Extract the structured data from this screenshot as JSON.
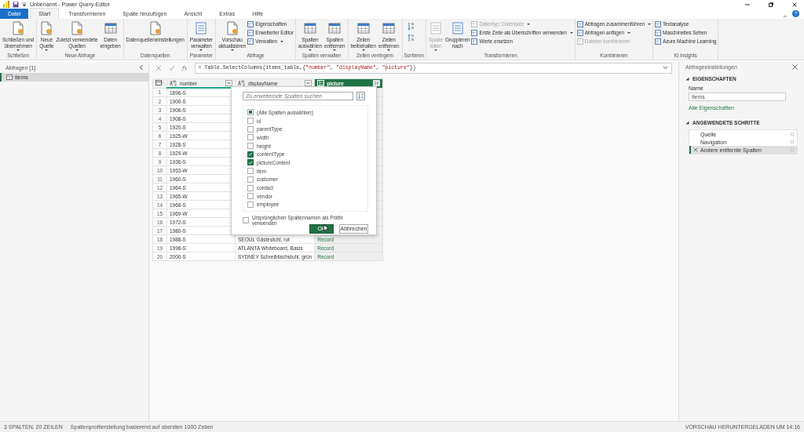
{
  "window": {
    "title": "Unbenannt - Power Query-Editor"
  },
  "tabs": [
    {
      "label": "Datei",
      "kind": "file",
      "selected": false
    },
    {
      "label": "Start",
      "kind": "tab",
      "selected": true
    },
    {
      "label": "Transformieren",
      "kind": "tab",
      "selected": false
    },
    {
      "label": "Spalte hinzufügen",
      "kind": "tab",
      "selected": false
    },
    {
      "label": "Ansicht",
      "kind": "tab",
      "selected": false
    },
    {
      "label": "Extras",
      "kind": "tab",
      "selected": false
    },
    {
      "label": "Hilfe",
      "kind": "tab",
      "selected": false
    }
  ],
  "ribbon": [
    {
      "label": "Schließen",
      "items": [
        {
          "kind": "large",
          "lines": [
            "Schließen und",
            "übernehmen"
          ],
          "dropdown": true,
          "disabled": false
        }
      ]
    },
    {
      "label": "Neue Abfrage",
      "items": [
        {
          "kind": "large",
          "lines": [
            "Neue",
            "Quelle"
          ],
          "dropdown": true,
          "disabled": false
        },
        {
          "kind": "large",
          "lines": [
            "Zuletzt verwendete",
            "Quellen"
          ],
          "dropdown": true,
          "disabled": false
        },
        {
          "kind": "large",
          "lines": [
            "Daten",
            "eingeben"
          ],
          "dropdown": false,
          "disabled": false
        }
      ]
    },
    {
      "label": "Datenquellen",
      "items": [
        {
          "kind": "large",
          "lines": [
            "Datenquelleneinstellungen"
          ],
          "dropdown": false,
          "disabled": false
        }
      ]
    },
    {
      "label": "Parameter",
      "items": [
        {
          "kind": "large",
          "lines": [
            "Parameter",
            "verwalten"
          ],
          "dropdown": true,
          "disabled": false
        }
      ]
    },
    {
      "label": "Abfrage",
      "items": [
        {
          "kind": "large",
          "lines": [
            "Vorschau",
            "aktualisieren"
          ],
          "dropdown": true,
          "disabled": false
        },
        {
          "kind": "stack",
          "items": [
            {
              "label": "Eigenschaften",
              "dropdown": false,
              "disabled": false
            },
            {
              "label": "Erweiterter Editor",
              "dropdown": false,
              "disabled": false
            },
            {
              "label": "Verwalten",
              "dropdown": true,
              "disabled": false
            }
          ]
        }
      ]
    },
    {
      "label": "Spalten verwalten",
      "items": [
        {
          "kind": "large",
          "lines": [
            "Spalten",
            "auswählen"
          ],
          "dropdown": true,
          "disabled": false
        },
        {
          "kind": "large",
          "lines": [
            "Spalten",
            "entfernen"
          ],
          "dropdown": true,
          "disabled": false
        }
      ]
    },
    {
      "label": "Zeilen verringern",
      "items": [
        {
          "kind": "large",
          "lines": [
            "Zeilen",
            "beibehalten"
          ],
          "dropdown": true,
          "disabled": false
        },
        {
          "kind": "large",
          "lines": [
            "Zeilen",
            "entfernen"
          ],
          "dropdown": true,
          "disabled": false
        }
      ]
    },
    {
      "label": "Sortieren",
      "items": [
        {
          "kind": "sort"
        }
      ]
    },
    {
      "label": "Transformieren",
      "items": [
        {
          "kind": "large",
          "lines": [
            "Spalte",
            "teilen"
          ],
          "dropdown": true,
          "disabled": true
        },
        {
          "kind": "large",
          "lines": [
            "Gruppieren",
            "nach"
          ],
          "dropdown": false,
          "disabled": false
        },
        {
          "kind": "stack",
          "items": [
            {
              "label": "Datentyp: Datensatz",
              "dropdown": true,
              "disabled": true
            },
            {
              "label": "Erste Zeile als Überschriften verwenden",
              "dropdown": true,
              "disabled": false
            },
            {
              "label": "Werte ersetzen",
              "dropdown": false,
              "disabled": false
            }
          ]
        }
      ]
    },
    {
      "label": "Kombinieren",
      "items": [
        {
          "kind": "stack",
          "items": [
            {
              "label": "Abfragen zusammenführen",
              "dropdown": true,
              "disabled": false
            },
            {
              "label": "Abfragen anfügen",
              "dropdown": true,
              "disabled": false
            },
            {
              "label": "Dateien kombinieren",
              "dropdown": false,
              "disabled": true
            }
          ]
        }
      ]
    },
    {
      "label": "KI Insights",
      "items": [
        {
          "kind": "stack",
          "items": [
            {
              "label": "Textanalyse",
              "dropdown": false,
              "disabled": false
            },
            {
              "label": "Maschinelles Sehen",
              "dropdown": false,
              "disabled": false
            },
            {
              "label": "Azure Machine Learning",
              "dropdown": false,
              "disabled": false
            }
          ]
        }
      ]
    }
  ],
  "queries": {
    "title": "Abfragen [1]",
    "items": [
      {
        "label": "items",
        "selected": true
      }
    ]
  },
  "formula": {
    "fx": "fx",
    "parts": [
      {
        "text": "= Table.SelectColumns(items_table,{",
        "kind": "code"
      },
      {
        "text": "\"number\"",
        "kind": "string"
      },
      {
        "text": ", ",
        "kind": "code"
      },
      {
        "text": "\"displayName\"",
        "kind": "string"
      },
      {
        "text": ", ",
        "kind": "code"
      },
      {
        "text": "\"picture\"",
        "kind": "string"
      },
      {
        "text": "})",
        "kind": "code"
      }
    ]
  },
  "table": {
    "columns": [
      {
        "name": "number",
        "kind": "text",
        "selected": false
      },
      {
        "name": "displayName",
        "kind": "text",
        "selected": false
      },
      {
        "name": "picture",
        "kind": "record",
        "selected": true
      }
    ],
    "rows": [
      {
        "index": "1",
        "number": "1896-S"
      },
      {
        "index": "2",
        "number": "1900-S"
      },
      {
        "index": "3",
        "number": "1906-S"
      },
      {
        "index": "4",
        "number": "1908-S"
      },
      {
        "index": "5",
        "number": "1920-S"
      },
      {
        "index": "6",
        "number": "1925-W"
      },
      {
        "index": "7",
        "number": "1928-S"
      },
      {
        "index": "8",
        "number": "1929-W"
      },
      {
        "index": "9",
        "number": "1936-S"
      },
      {
        "index": "10",
        "number": "1953-W"
      },
      {
        "index": "11",
        "number": "1960-S"
      },
      {
        "index": "12",
        "number": "1964-S"
      },
      {
        "index": "13",
        "number": "1965-W"
      },
      {
        "index": "14",
        "number": "1968-S"
      },
      {
        "index": "15",
        "number": "1969-W"
      },
      {
        "index": "16",
        "number": "1972-S"
      },
      {
        "index": "17",
        "number": "1980-S"
      },
      {
        "index": "18",
        "number": "1988-S",
        "displayName": "SEOUL Gästestuhl, rot",
        "picture": "Record"
      },
      {
        "index": "19",
        "number": "1996-S",
        "displayName": "ATLANTA Whiteboard, Basis",
        "picture": "Record"
      },
      {
        "index": "20",
        "number": "2000-S",
        "displayName": "SYDNEY Schreibtischstuhl, grün",
        "picture": "Record"
      }
    ]
  },
  "expand_menu": {
    "search": {
      "placeholder": "Zu erweiternde Spalten suchen"
    },
    "options": [
      {
        "label": "(Alle Spalten auswählen)",
        "checked": false,
        "partial": true
      },
      {
        "label": "id",
        "checked": false,
        "partial": false
      },
      {
        "label": "parentType",
        "checked": false,
        "partial": false
      },
      {
        "label": "width",
        "checked": false,
        "partial": false
      },
      {
        "label": "height",
        "checked": false,
        "partial": false
      },
      {
        "label": "contentType",
        "checked": true,
        "partial": false
      },
      {
        "label": "pictureContent",
        "checked": true,
        "partial": false
      },
      {
        "label": "item",
        "checked": false,
        "partial": false
      },
      {
        "label": "customer",
        "checked": false,
        "partial": false
      },
      {
        "label": "contact",
        "checked": false,
        "partial": false
      },
      {
        "label": "vendor",
        "checked": false,
        "partial": false
      },
      {
        "label": "employee",
        "checked": false,
        "partial": false
      }
    ],
    "prefix": {
      "label": "Ursprünglichen Spaltennamen als Präfix verwenden",
      "checked": false
    },
    "ok": "OK",
    "cancel": "Abbrechen"
  },
  "settings": {
    "title": "Abfrageeinstellungen",
    "properties_heading": "EIGENSCHAFTEN",
    "name_label": "Name",
    "name_value": "items",
    "all_properties": "Alle Eigenschaften",
    "steps_heading": "ANGEWENDETE SCHRITTE",
    "steps": [
      {
        "label": "Quelle",
        "selected": false
      },
      {
        "label": "Navigation",
        "selected": false
      },
      {
        "label": "Andere entfernte Spalten",
        "selected": true
      }
    ]
  },
  "status_bar": {
    "summary": "3 SPALTEN, 20 ZEILEN",
    "profiling": "Spaltenprofilerstellung basierend auf obersten 1000 Zeilen",
    "right": "VORSCHAU HERUNTERGELADEN UM 14:16"
  }
}
